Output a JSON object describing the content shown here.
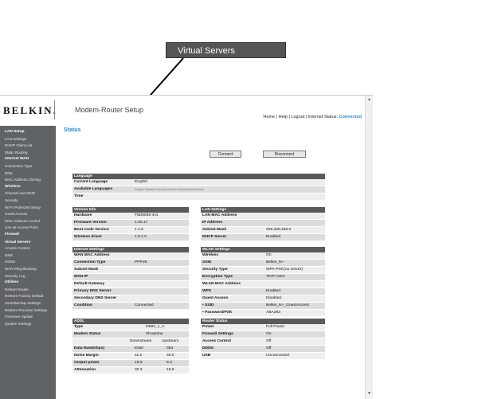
{
  "callout": {
    "text": "Virtual Servers"
  },
  "header": {
    "logo": "BELKIN.",
    "title": "Modem-Router Setup",
    "links": {
      "home": "Home",
      "help": "Help",
      "logout": "Logout",
      "sep": "|",
      "internet_status_label": "Internet Status:",
      "internet_status_value": "Connected"
    }
  },
  "sidebar": {
    "groups": [
      {
        "title": "LAN Setup",
        "items": [
          "LAN Settings",
          "DHCP Client List",
          "Static Routing"
        ]
      },
      {
        "title": "Internet WAN",
        "items": [
          "Connection Type",
          "DNS",
          "MAC Address Cloning"
        ]
      },
      {
        "title": "Wireless",
        "items": [
          "Channel and SSID",
          "Security",
          "Wi-Fi Protected Setup",
          "Guest Access",
          "MAC Address Control",
          "Use as Access Point"
        ]
      },
      {
        "title": "Firewall",
        "items": [
          "Virtual Servers",
          "Access Control",
          "DMZ",
          "DDNS",
          "WAN Ping Blocking",
          "Security Log"
        ]
      },
      {
        "title": "Utilities",
        "items": [
          "Restart Router",
          "Restore Factory Default",
          "Save/Backup Settings",
          "Restore Previous Settings",
          "Firmware Update",
          "System Settings"
        ]
      }
    ],
    "selected": "Virtual Servers"
  },
  "main": {
    "title": "Status",
    "connect_label": "Connect",
    "disconnect_label": "Disconnect",
    "language": {
      "title": "Language",
      "current_label": "Current Language",
      "current_value": "English",
      "available_label": "Available Languages",
      "available_value": "English  Español  Français  Deutsch  Nederlands  Italiano",
      "time_label": "Time"
    },
    "version": {
      "title": "Version Info",
      "rows": [
        {
          "label": "Hardware",
          "value": "F5D8635-4v1"
        },
        {
          "label": "Firmware Version",
          "value": "1.00.17"
        },
        {
          "label": "Boot Code Version",
          "value": "1.1.5"
        },
        {
          "label": "Wireless driver",
          "value": "1.8.1.0"
        }
      ]
    },
    "lan": {
      "title": "LAN Settings",
      "rows": [
        {
          "label": "LAN MAC Address",
          "value": ""
        },
        {
          "label": "IP Address",
          "value": ""
        },
        {
          "label": "Subnet Mask",
          "value": "255.255.255.0"
        },
        {
          "label": "DHCP Server",
          "value": "Enabled"
        }
      ]
    },
    "internet": {
      "title": "Internet Settings",
      "rows": [
        {
          "label": "WAN MAC Address",
          "value": ""
        },
        {
          "label": "Connection Type",
          "value": "PPPoE"
        },
        {
          "label": "Subnet Mask",
          "value": ""
        },
        {
          "label": "WAN IP",
          "value": ""
        },
        {
          "label": "Default Gateway",
          "value": ""
        },
        {
          "label": "Primary DNS Server",
          "value": ""
        },
        {
          "label": "Secondary DNS Server",
          "value": ""
        },
        {
          "label": "Condition",
          "value": "Connected"
        }
      ]
    },
    "wlan": {
      "title": "WLAN Settings",
      "rows": [
        {
          "label": "Wireless",
          "value": "On"
        },
        {
          "label": "SSID",
          "value": "Belkin_N+"
        },
        {
          "label": "Security Type",
          "value": "WPA-PSK(no server)"
        },
        {
          "label": "Encryption Type",
          "value": "TKIP+AES"
        },
        {
          "label": "WLAN MAC Address",
          "value": ""
        },
        {
          "label": "WPS",
          "value": "Enabled"
        },
        {
          "label": "Guest Access",
          "value": "Disabled"
        },
        {
          "label": "• SSID",
          "value": "Belkin_N+_GuestAccess"
        },
        {
          "label": "• Password/PSK",
          "value": "ABA283"
        }
      ]
    },
    "adsl": {
      "title": "ADSL",
      "type_label": "Type",
      "type_value": "G992_1_A",
      "modem_label": "Modem Status",
      "modem_value": "Showtime",
      "downstream": "Downstream",
      "upstream": "Upstream",
      "rows": [
        {
          "label": "Data Rate(Kbps)",
          "down": "8160",
          "up": "384"
        },
        {
          "label": "Noise Margin",
          "down": "11.5",
          "up": "30.0"
        },
        {
          "label": "Output power",
          "down": "19.9",
          "up": "6.3"
        },
        {
          "label": "Attenuation",
          "down": "30.3",
          "up": "15.5"
        }
      ]
    },
    "router": {
      "title": "Router Status",
      "rows": [
        {
          "label": "Power",
          "value": "Full Power"
        },
        {
          "label": "Firewall Settings",
          "value": "On"
        },
        {
          "label": "Access Control",
          "value": "Off"
        },
        {
          "label": "DDNS",
          "value": "Off"
        },
        {
          "label": "USB",
          "value": "Unconnected"
        }
      ]
    }
  },
  "colors": {
    "accent": "#2a8ad9",
    "sidebar": "#5f6366",
    "panel_head": "#5a5a5a"
  }
}
